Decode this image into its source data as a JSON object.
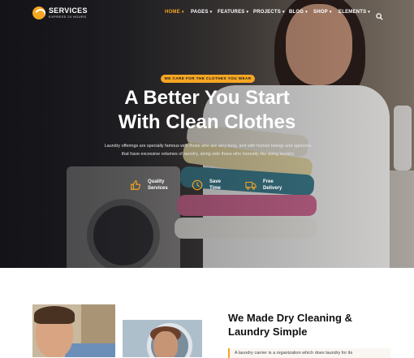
{
  "logo": {
    "title": "SERVICES",
    "subtitle": "EXPRESS 24 HOURS",
    "icon": "logo-icon"
  },
  "nav": {
    "items": [
      {
        "label": "HOME",
        "active": true
      },
      {
        "label": "PAGES",
        "active": false
      },
      {
        "label": "FEATURES",
        "active": false
      },
      {
        "label": "PROJECTS",
        "active": false
      },
      {
        "label": "BLOG",
        "active": false
      },
      {
        "label": "SHOP",
        "active": false
      },
      {
        "label": "ELEMENTS",
        "active": false
      }
    ],
    "search_icon": "search-icon"
  },
  "hero": {
    "tagline": "WE CARE FOR THE CLOTHES YOU WEAR",
    "headline_line1": "A Better You Start",
    "headline_line2": "With Clean Clothes",
    "description": "Laundry offerings are specially famous with those who are very busy, and with human beings and agencies that have excessive volumes of laundry, along side those who honestly like doing laundry",
    "features": [
      {
        "icon": "thumbs-up-icon",
        "line1": "Quality",
        "line2": "Services"
      },
      {
        "icon": "clock-icon",
        "line1": "Save",
        "line2": "Time"
      },
      {
        "icon": "truck-icon",
        "line1": "Free",
        "line2": "Delivery"
      }
    ]
  },
  "about": {
    "title_line1": "We Made Dry Cleaning &",
    "title_line2": "Laundry Simple",
    "quote": "A laundry carrier is a organization which does laundry for its"
  },
  "colors": {
    "accent": "#f5a623",
    "dark": "#111111"
  }
}
